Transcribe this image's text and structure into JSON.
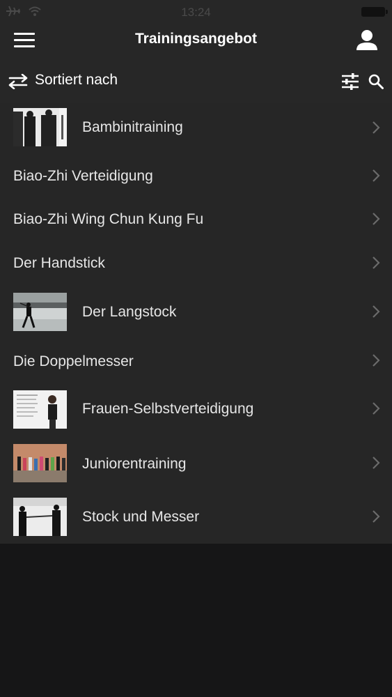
{
  "status_bar": {
    "time": "13:24"
  },
  "nav": {
    "title": "Trainingsangebot"
  },
  "sort": {
    "label": "Sortiert nach"
  },
  "items": [
    {
      "label": "Bambinitraining",
      "has_thumbnail": true
    },
    {
      "label": "Biao-Zhi Verteidigung",
      "has_thumbnail": false
    },
    {
      "label": "Biao-Zhi Wing Chun Kung Fu",
      "has_thumbnail": false
    },
    {
      "label": "Der Handstick",
      "has_thumbnail": false
    },
    {
      "label": "Der Langstock",
      "has_thumbnail": true
    },
    {
      "label": "Die Doppelmesser",
      "has_thumbnail": false
    },
    {
      "label": "Frauen-Selbstverteidigung",
      "has_thumbnail": true
    },
    {
      "label": "Juniorentraining",
      "has_thumbnail": true
    },
    {
      "label": "Stock und Messer",
      "has_thumbnail": true
    }
  ],
  "colors": {
    "bar_bg": "#272727",
    "list_bg": "#262626",
    "page_bg": "#161617",
    "text": "#e6e6e6",
    "chevron": "#6b6b6b"
  }
}
